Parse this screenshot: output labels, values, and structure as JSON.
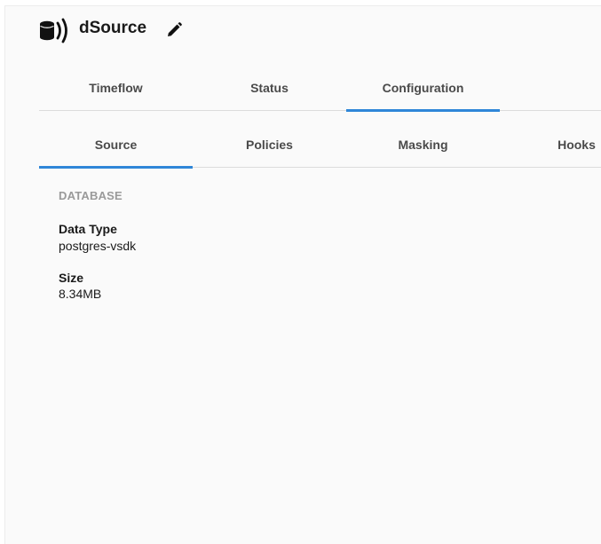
{
  "header": {
    "title": "dSource",
    "icon": "dsource-database-icon",
    "edit_icon": "pencil-icon"
  },
  "primary_tabs": [
    {
      "label": "Timeflow",
      "active": false
    },
    {
      "label": "Status",
      "active": false
    },
    {
      "label": "Configuration",
      "active": true
    }
  ],
  "secondary_tabs": [
    {
      "label": "Source",
      "active": true
    },
    {
      "label": "Policies",
      "active": false
    },
    {
      "label": "Masking",
      "active": false
    },
    {
      "label": "Hooks",
      "active": false
    }
  ],
  "database": {
    "section_title": "DATABASE",
    "data_type_label": "Data Type",
    "data_type_value": "postgres-vsdk",
    "size_label": "Size",
    "size_value": "8.34MB"
  },
  "colors": {
    "accent": "#2f86d8",
    "section_title": "#9a9a9a",
    "background": "#fafafa"
  }
}
